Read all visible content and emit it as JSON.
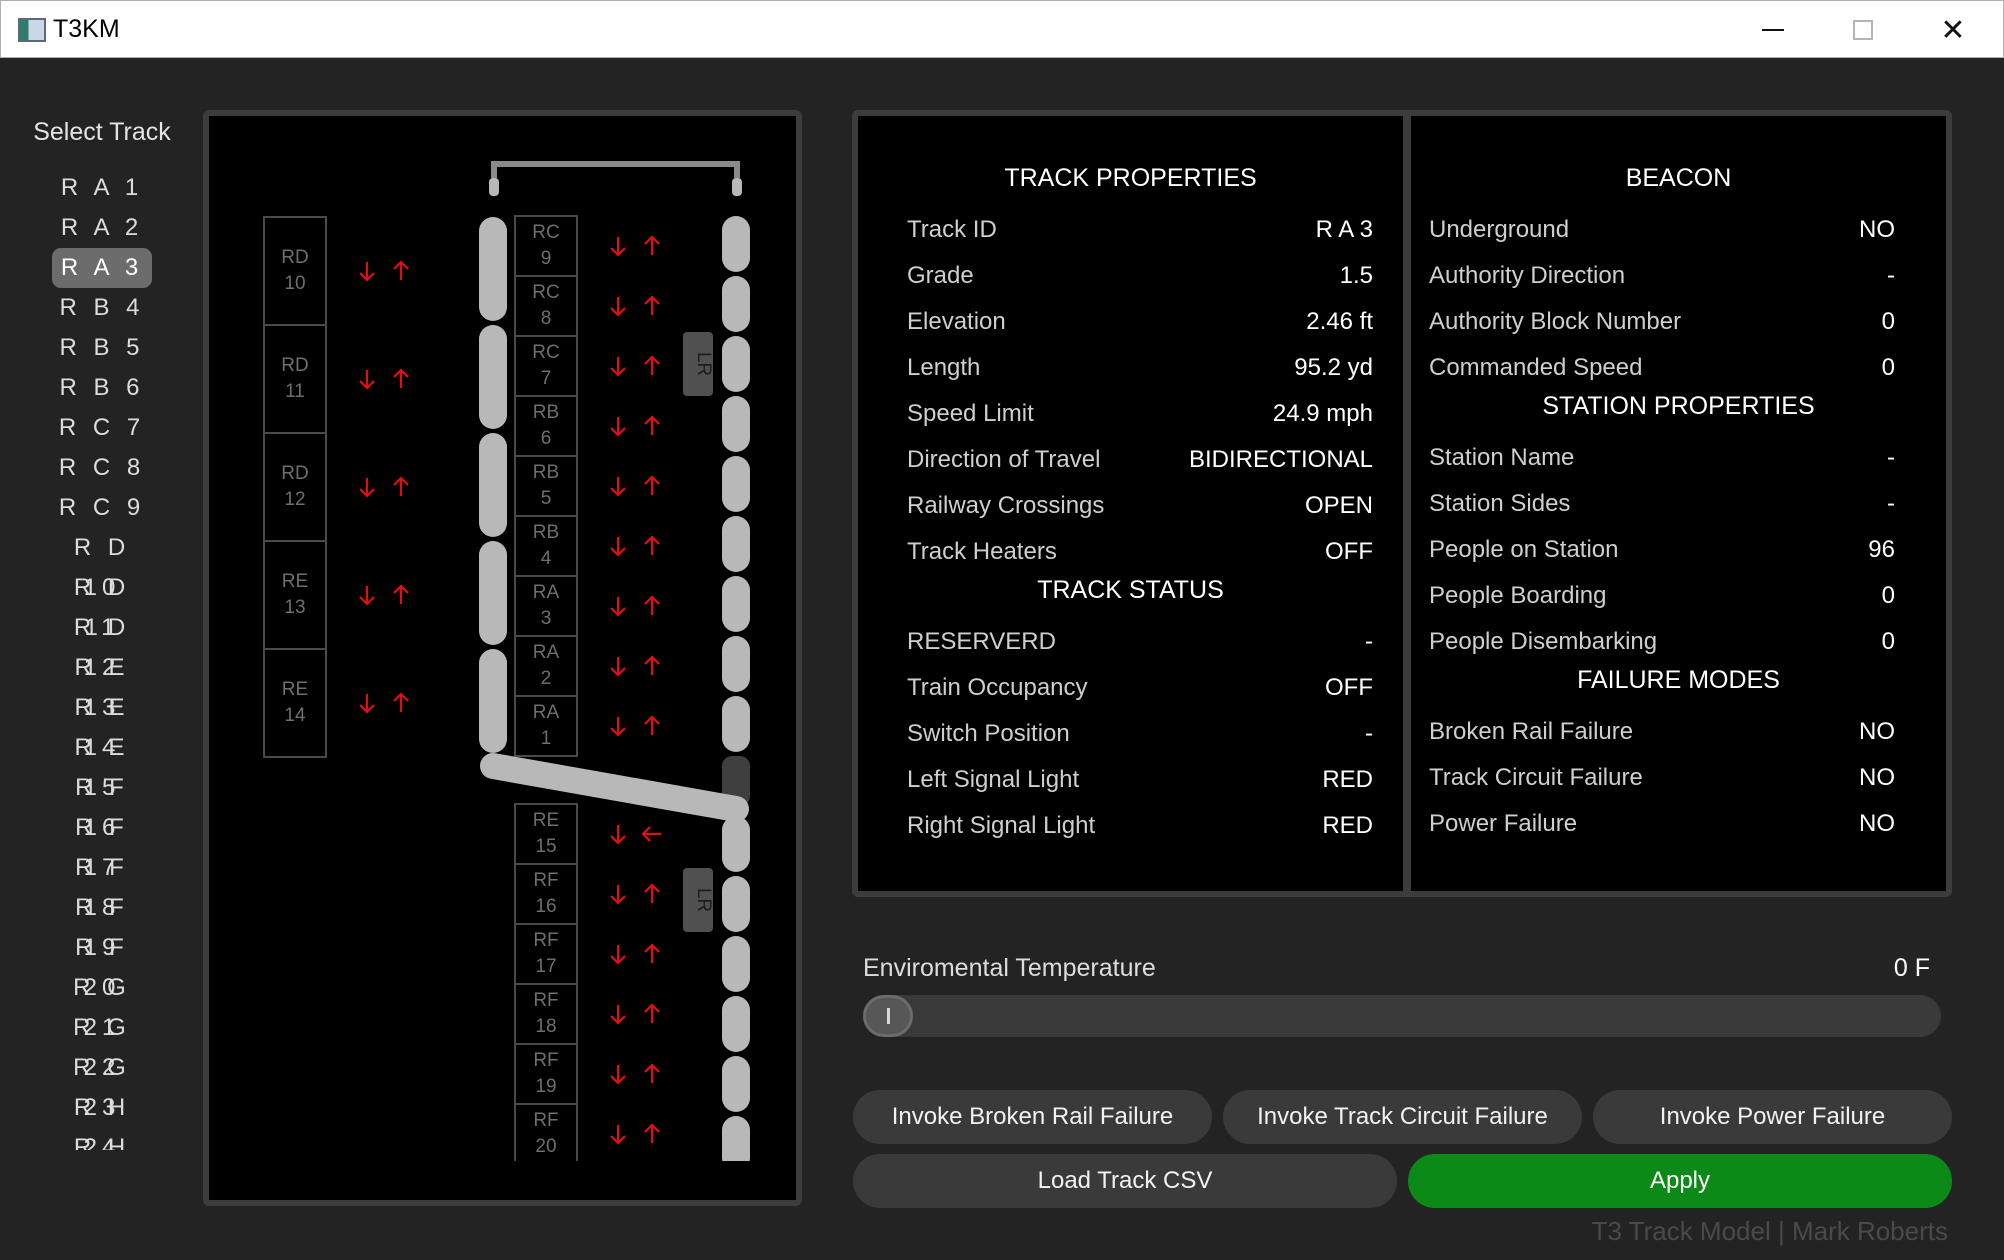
{
  "window": {
    "title": "T3KM",
    "minimize_glyph": "—",
    "maximize_glyph": "☐",
    "close_glyph": "✕"
  },
  "track_list": {
    "title": "Select Track",
    "selected": "R A 3",
    "items": [
      "R A 1",
      "R A 2",
      "R A 3",
      "R B 4",
      "R B 5",
      "R B 6",
      "R C 7",
      "R C 8",
      "R C 9",
      "R D 10",
      "R D 11",
      "R D 12",
      "R E 13",
      "R E 14",
      "R E 15",
      "R F 16",
      "R F 17",
      "R F 18",
      "R F 19",
      "R F 20",
      "R G 21",
      "R G 22",
      "R G 23",
      "R H 24",
      "R H 25"
    ]
  },
  "track_map": {
    "left_blocks": [
      {
        "label": [
          "RD",
          "10"
        ]
      },
      {
        "label": [
          "RD",
          "11"
        ]
      },
      {
        "label": [
          "RD",
          "12"
        ]
      },
      {
        "label": [
          "RE",
          "13"
        ]
      },
      {
        "label": [
          "RE",
          "14"
        ]
      }
    ],
    "upper_blocks": [
      {
        "label": [
          "RC",
          "9"
        ]
      },
      {
        "label": [
          "RC",
          "8"
        ]
      },
      {
        "label": [
          "RC",
          "7"
        ]
      },
      {
        "label": [
          "RB",
          "6"
        ]
      },
      {
        "label": [
          "RB",
          "5"
        ]
      },
      {
        "label": [
          "RB",
          "4"
        ]
      },
      {
        "label": [
          "RA",
          "3"
        ]
      },
      {
        "label": [
          "RA",
          "2"
        ]
      },
      {
        "label": [
          "RA",
          "1"
        ]
      }
    ],
    "lower_blocks": [
      {
        "label": [
          "RE",
          "15"
        ]
      },
      {
        "label": [
          "RF",
          "16"
        ]
      },
      {
        "label": [
          "RF",
          "17"
        ]
      },
      {
        "label": [
          "RF",
          "18"
        ]
      },
      {
        "label": [
          "RF",
          "19"
        ]
      },
      {
        "label": [
          "RF",
          "20"
        ]
      }
    ],
    "switch_labels": [
      "LR",
      "LR"
    ],
    "arrow_color": "#e01010",
    "track_color": "#b8b8b8"
  },
  "track_properties": {
    "title": "TRACK PROPERTIES",
    "rows": [
      {
        "label": "Track ID",
        "value": "R A 3"
      },
      {
        "label": "Grade",
        "value": "1.5"
      },
      {
        "label": "Elevation",
        "value": "2.46 ft"
      },
      {
        "label": "Length",
        "value": "95.2 yd"
      },
      {
        "label": "Speed Limit",
        "value": "24.9 mph"
      },
      {
        "label": "Direction of Travel",
        "value": "BIDIRECTIONAL"
      },
      {
        "label": "Railway Crossings",
        "value": "OPEN"
      },
      {
        "label": "Track Heaters",
        "value": "OFF"
      }
    ]
  },
  "track_status": {
    "title": "TRACK STATUS",
    "rows": [
      {
        "label": "RESERVERD",
        "value": "-"
      },
      {
        "label": "Train Occupancy",
        "value": "OFF"
      },
      {
        "label": "Switch Position",
        "value": "-"
      },
      {
        "label": "Left Signal Light",
        "value": "RED"
      },
      {
        "label": "Right Signal Light",
        "value": "RED"
      }
    ]
  },
  "beacon": {
    "title": "BEACON",
    "rows": [
      {
        "label": "Underground",
        "value": "NO"
      },
      {
        "label": "Authority Direction",
        "value": "-"
      },
      {
        "label": "Authority Block Number",
        "value": "0"
      },
      {
        "label": "Commanded Speed",
        "value": "0"
      }
    ]
  },
  "station_properties": {
    "title": "STATION PROPERTIES",
    "rows": [
      {
        "label": "Station Name",
        "value": "-"
      },
      {
        "label": "Station Sides",
        "value": "-"
      },
      {
        "label": "People on Station",
        "value": "96"
      },
      {
        "label": "People Boarding",
        "value": "0"
      },
      {
        "label": "People Disembarking",
        "value": "0"
      }
    ]
  },
  "failure_modes": {
    "title": "FAILURE MODES",
    "rows": [
      {
        "label": "Broken Rail Failure",
        "value": "NO"
      },
      {
        "label": "Track Circuit Failure",
        "value": "NO"
      },
      {
        "label": "Power Failure",
        "value": "NO"
      }
    ]
  },
  "temperature": {
    "label": "Enviromental Temperature",
    "value_text": "0 F",
    "slider_fraction": 0.0
  },
  "buttons": {
    "broken_rail": "Invoke Broken Rail Failure",
    "track_circuit": "Invoke Track Circuit Failure",
    "power": "Invoke Power Failure",
    "load_csv": "Load Track CSV",
    "apply": "Apply"
  },
  "colors": {
    "apply": "#0b8a17",
    "selected_item": "#6c6c6c"
  },
  "footer": "T3 Track Model | Mark Roberts"
}
